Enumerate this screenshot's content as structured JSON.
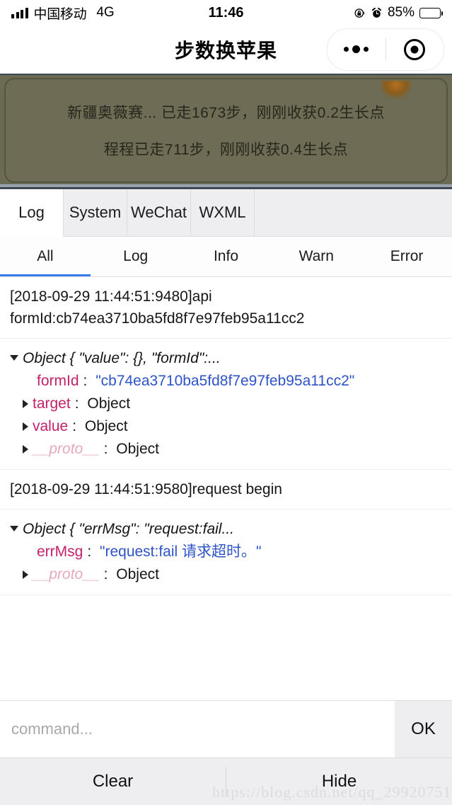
{
  "status_bar": {
    "carrier": "中国移动",
    "network": "4G",
    "time": "11:46",
    "battery_percent": "85%",
    "icons": [
      "signal-bars-icon",
      "rotation-lock-icon",
      "alarm-clock-icon",
      "battery-icon"
    ]
  },
  "nav_bar": {
    "title": "步数换苹果",
    "capsule": {
      "more_icon": "more-dots-icon",
      "target_icon": "target-circle-icon"
    }
  },
  "game_banner": {
    "messages": [
      "新疆奥薇赛... 已走1673步，刚刚收获0.2生长点",
      "程程已走711步，刚刚收获0.4生长点"
    ],
    "panel_color": "#6e6c55",
    "border_color": "#55553f",
    "decoration": "leaf-decoration-icon"
  },
  "debug_panel": {
    "main_tabs": [
      {
        "label": "Log",
        "active": true
      },
      {
        "label": "System",
        "active": false
      },
      {
        "label": "WeChat",
        "active": false
      },
      {
        "label": "WXML",
        "active": false
      }
    ],
    "filter_tabs": [
      {
        "label": "All",
        "active": true
      },
      {
        "label": "Log",
        "active": false
      },
      {
        "label": "Info",
        "active": false
      },
      {
        "label": "Warn",
        "active": false
      },
      {
        "label": "Error",
        "active": false
      }
    ],
    "active_indicator_color": "#3b7cec",
    "entries": [
      {
        "type": "text",
        "lines": [
          "[2018-09-29 11:44:51:9480]api",
          "formId:cb74ea3710ba5fd8f7e97feb95a11cc2"
        ]
      },
      {
        "type": "object",
        "header": "Object { \"value\": {}, \"formId\":...",
        "expanded": true,
        "props": [
          {
            "key": "formId",
            "value": "\"cb74ea3710ba5fd8f7e97feb95a11cc2\"",
            "value_kind": "string",
            "has_toggle": false,
            "is_proto": false
          },
          {
            "key": "target",
            "value": "Object",
            "value_kind": "object",
            "has_toggle": true,
            "is_proto": false
          },
          {
            "key": "value",
            "value": "Object",
            "value_kind": "object",
            "has_toggle": true,
            "is_proto": false
          },
          {
            "key": "__proto__",
            "value": "Object",
            "value_kind": "object",
            "has_toggle": true,
            "is_proto": true
          }
        ]
      },
      {
        "type": "text",
        "lines": [
          "[2018-09-29 11:44:51:9580]request begin"
        ]
      },
      {
        "type": "object",
        "header": "Object { \"errMsg\": \"request:fail...",
        "expanded": true,
        "props": [
          {
            "key": "errMsg",
            "value": "\"request:fail 请求超时。\"",
            "value_kind": "string",
            "has_toggle": false,
            "is_proto": false
          },
          {
            "key": "__proto__",
            "value": "Object",
            "value_kind": "object",
            "has_toggle": true,
            "is_proto": true
          }
        ]
      }
    ],
    "key_color": "#c4216b",
    "string_color": "#2f53c8"
  },
  "command_bar": {
    "input_value": "",
    "placeholder": "command...",
    "ok_label": "OK"
  },
  "action_bar": {
    "clear_label": "Clear",
    "hide_label": "Hide"
  },
  "watermark": {
    "text": "https://blog.csdn.net/qq_29920751"
  }
}
